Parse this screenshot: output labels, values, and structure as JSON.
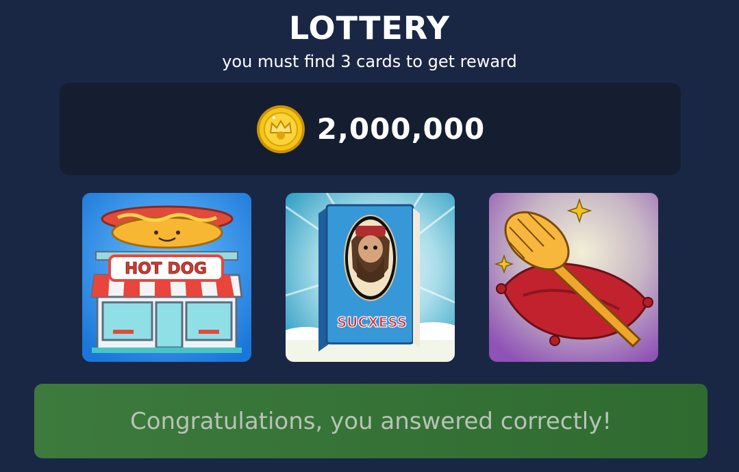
{
  "header": {
    "title": "LOTTERY",
    "subtitle": "you must find 3 cards to get reward"
  },
  "reward": {
    "amount": "2,000,000",
    "icon": "gold-coin-icon"
  },
  "cards": [
    {
      "label": "HOT DOG",
      "image": "hot-dog-stand"
    },
    {
      "label": "SUCXESS",
      "image": "book-with-bearded-man"
    },
    {
      "label": "",
      "image": "toilet-brush-on-red-pillow"
    }
  ],
  "result": {
    "message": "Congratulations, you answered correctly!",
    "color": "#3a763a"
  }
}
